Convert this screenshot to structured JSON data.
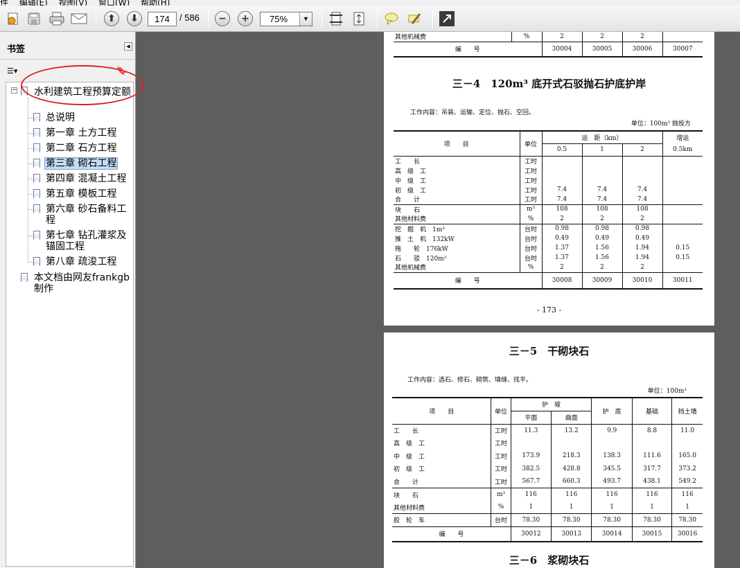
{
  "toolbar": {
    "page_current": "174",
    "page_total": "/ 586",
    "zoom": "75%"
  },
  "sidebar": {
    "title": "书签",
    "items": [
      {
        "label": "水利建筑工程预算定额"
      },
      {
        "label": "总说明"
      },
      {
        "label": "第一章 土方工程"
      },
      {
        "label": "第二章 石方工程"
      },
      {
        "label": "第三章 砌石工程"
      },
      {
        "label": "第四章 混凝土工程"
      },
      {
        "label": "第五章 模板工程"
      },
      {
        "label": "第六章 砂石备料工程"
      },
      {
        "label": "第七章 钻孔灌浆及锚固工程"
      },
      {
        "label": "第八章 疏浚工程"
      },
      {
        "label": "本文档由网友frankgb制作"
      }
    ]
  },
  "page1": {
    "top_rows": [
      {
        "name": "其他机械费",
        "unit": "%",
        "v": [
          "2",
          "2",
          "2",
          ""
        ]
      },
      {
        "name": "编　　号",
        "unit": "",
        "v": [
          "30004",
          "30005",
          "30006",
          "30007"
        ]
      }
    ],
    "title": "三－4　120m³ 底开式石驳抛石护底护岸",
    "work": "工作内容：吊装、运输、定位、抛石、空回。",
    "unit": "单位：100m³ 抛投方",
    "head": {
      "item": "项　　目",
      "unit": "单位",
      "group": "运　距（km）",
      "c": [
        "0.5",
        "1",
        "2"
      ],
      "extra": "增运",
      "extra2": "0.5km"
    },
    "rows": [
      {
        "name": "工　　长",
        "unit": "工时",
        "v": [
          "",
          "",
          "",
          ""
        ]
      },
      {
        "name": "高　级　工",
        "unit": "工时",
        "v": [
          "",
          "",
          "",
          ""
        ]
      },
      {
        "name": "中　级　工",
        "unit": "工时",
        "v": [
          "",
          "",
          "",
          ""
        ]
      },
      {
        "name": "初　级　工",
        "unit": "工时",
        "v": [
          "7.4",
          "7.4",
          "7.4",
          ""
        ]
      },
      {
        "name": "合　　计",
        "unit": "工时",
        "v": [
          "7.4",
          "7.4",
          "7.4",
          ""
        ]
      },
      {
        "name": "块　　石",
        "unit": "m³",
        "v": [
          "108",
          "108",
          "108",
          ""
        ]
      },
      {
        "name": "其他材料费",
        "unit": "%",
        "v": [
          "2",
          "2",
          "2",
          ""
        ]
      },
      {
        "name": "挖　掘　机　1m³",
        "unit": "台时",
        "v": [
          "0.98",
          "0.98",
          "0.98",
          ""
        ]
      },
      {
        "name": "推　土　机　132kW",
        "unit": "台时",
        "v": [
          "0.49",
          "0.49",
          "0.49",
          ""
        ]
      },
      {
        "name": "拖　　轮　176kW",
        "unit": "台时",
        "v": [
          "1.37",
          "1.56",
          "1.94",
          "0.15"
        ]
      },
      {
        "name": "石　　驳　120m³",
        "unit": "台时",
        "v": [
          "1.37",
          "1.56",
          "1.94",
          "0.15"
        ]
      },
      {
        "name": "其他机械费",
        "unit": "%",
        "v": [
          "2",
          "2",
          "2",
          ""
        ]
      }
    ],
    "code": {
      "name": "编　　号",
      "v": [
        "30008",
        "30009",
        "30010",
        "30011"
      ]
    },
    "page_number": "- 173 -"
  },
  "page2": {
    "title": "三－5　干砌块石",
    "work": "工作内容：选石、修石、砌筑、填缝、找平。",
    "unit": "单位：100m³",
    "head": {
      "item": "项　　目",
      "unit": "单位",
      "group": "护　坡",
      "c1": "平面",
      "c2": "曲面",
      "c3": "护　底",
      "c4": "基础",
      "c5": "挡土墙"
    },
    "rows": [
      {
        "name": "工　　长",
        "unit": "工时",
        "v": [
          "11.3",
          "13.2",
          "9.9",
          "8.8",
          "11.0"
        ]
      },
      {
        "name": "高　级　工",
        "unit": "工时",
        "v": [
          "",
          "",
          "",
          "",
          ""
        ]
      },
      {
        "name": "中　级　工",
        "unit": "工时",
        "v": [
          "173.9",
          "218.3",
          "138.3",
          "111.6",
          "165.0"
        ]
      },
      {
        "name": "初　级　工",
        "unit": "工时",
        "v": [
          "382.5",
          "428.8",
          "345.5",
          "317.7",
          "373.2"
        ]
      },
      {
        "name": "合　　计",
        "unit": "工时",
        "v": [
          "567.7",
          "660.3",
          "493.7",
          "438.1",
          "549.2"
        ]
      },
      {
        "name": "块　　石",
        "unit": "m³",
        "v": [
          "116",
          "116",
          "116",
          "116",
          "116"
        ]
      },
      {
        "name": "其他材料费",
        "unit": "%",
        "v": [
          "1",
          "1",
          "1",
          "1",
          "1"
        ]
      },
      {
        "name": "胶　轮　车",
        "unit": "台时",
        "v": [
          "78.30",
          "78.30",
          "78.30",
          "78.30",
          "78.30"
        ]
      }
    ],
    "code": {
      "name": "编　　号",
      "v": [
        "30012",
        "30013",
        "30014",
        "30015",
        "30016"
      ]
    },
    "next_title": "三－6　浆砌块石"
  }
}
